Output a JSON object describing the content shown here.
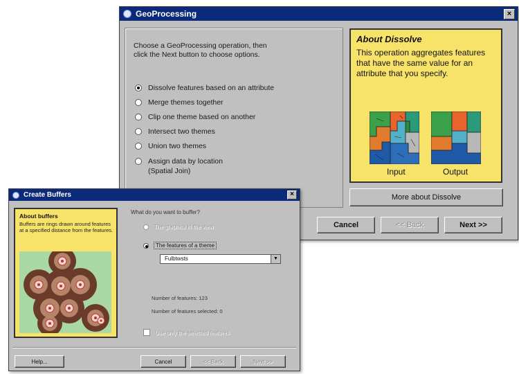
{
  "geoprocessing": {
    "title": "GeoProcessing",
    "close_glyph": "×",
    "instructions": "Choose a GeoProcessing operation, then click the Next button to choose options.",
    "options": [
      {
        "label": "Dissolve features based on an attribute",
        "selected": true
      },
      {
        "label": "Merge themes together",
        "selected": false
      },
      {
        "label": "Clip one theme based on another",
        "selected": false
      },
      {
        "label": "Intersect two themes",
        "selected": false
      },
      {
        "label": "Union two themes",
        "selected": false
      },
      {
        "label": "Assign data by location",
        "label2": "(Spatial Join)",
        "selected": false
      }
    ],
    "about": {
      "title": "About Dissolve",
      "text": "This operation aggregates features that have the same value for an attribute that you specify.",
      "input_caption": "Input",
      "output_caption": "Output"
    },
    "more_button": "More about Dissolve",
    "cancel_button": "Cancel",
    "back_button": "<< Back",
    "next_button": "Next >>"
  },
  "buffers": {
    "title": "Create Buffers",
    "close_glyph": "×",
    "about_title": "About buffers",
    "about_text": "Buffers are rings drawn around features at a specified distance from the features.",
    "question": "What do you want to buffer?",
    "option1": "The graphics in the view",
    "option2": "The features of a theme",
    "theme_value": "Fulbtwsts",
    "num_features": "Number of features: 123",
    "num_selected": "Number of features selected: 0",
    "checkbox_label": "Use only the selected features",
    "help_button": "Help...",
    "cancel_button": "Cancel",
    "back_button": "<< Back",
    "next_button": "Next >>"
  },
  "colors": {
    "titlebar": "#0b2a7a",
    "about_panel": "#f7e36a",
    "buffer_map_bg": "#a9d8a4",
    "buffer_ring": "#6a3a2a"
  }
}
